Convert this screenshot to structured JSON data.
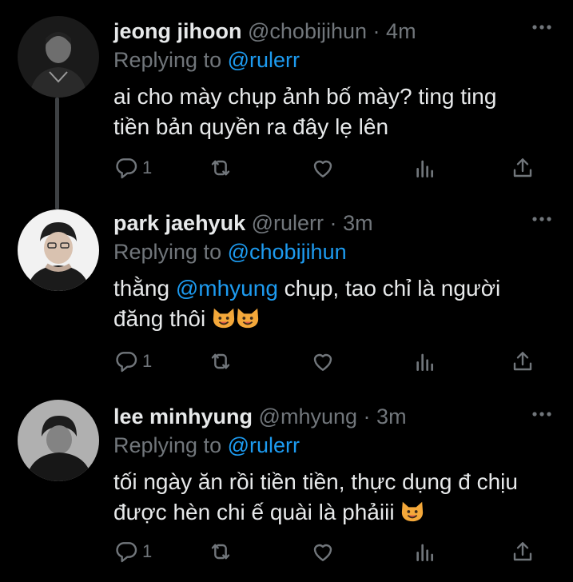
{
  "colors": {
    "accent": "#1d9bf0",
    "muted": "#71767b",
    "text": "#e7e9ea",
    "bg": "#000000"
  },
  "tweets": [
    {
      "name": "jeong jihoon",
      "handle": "@chobijihun",
      "separator": "·",
      "time": "4m",
      "replying_prefix": "Replying to",
      "replying_handle": "@rulerr",
      "text_lines": [
        "ai cho mày chụp ảnh bố mày? ting ting",
        "tiền bản quyền ra đây lẹ lên"
      ],
      "reply_count": "1",
      "icons": [
        "reply-icon",
        "retweet-icon",
        "like-icon",
        "views-icon",
        "share-icon",
        "more-icon"
      ]
    },
    {
      "name": "park jaehyuk",
      "handle": "@rulerr",
      "separator": "·",
      "time": "3m",
      "replying_prefix": "Replying to",
      "replying_handle": "@chobijihun",
      "text_line1_pre": "thằng ",
      "text_line1_mention": "@mhyung",
      "text_line1_post": " chụp, tao chỉ là người",
      "text_line2": "đăng thôi",
      "reply_count": "1"
    },
    {
      "name": "lee minhyung",
      "handle": "@mhyung",
      "separator": "·",
      "time": "3m",
      "replying_prefix": "Replying to",
      "replying_handle": "@rulerr",
      "text_lines": [
        "tối ngày ăn rồi tiền tiền, thực dụng đ chịu",
        "được hèn chi ế quài là phảiii"
      ],
      "reply_count": "1"
    }
  ]
}
